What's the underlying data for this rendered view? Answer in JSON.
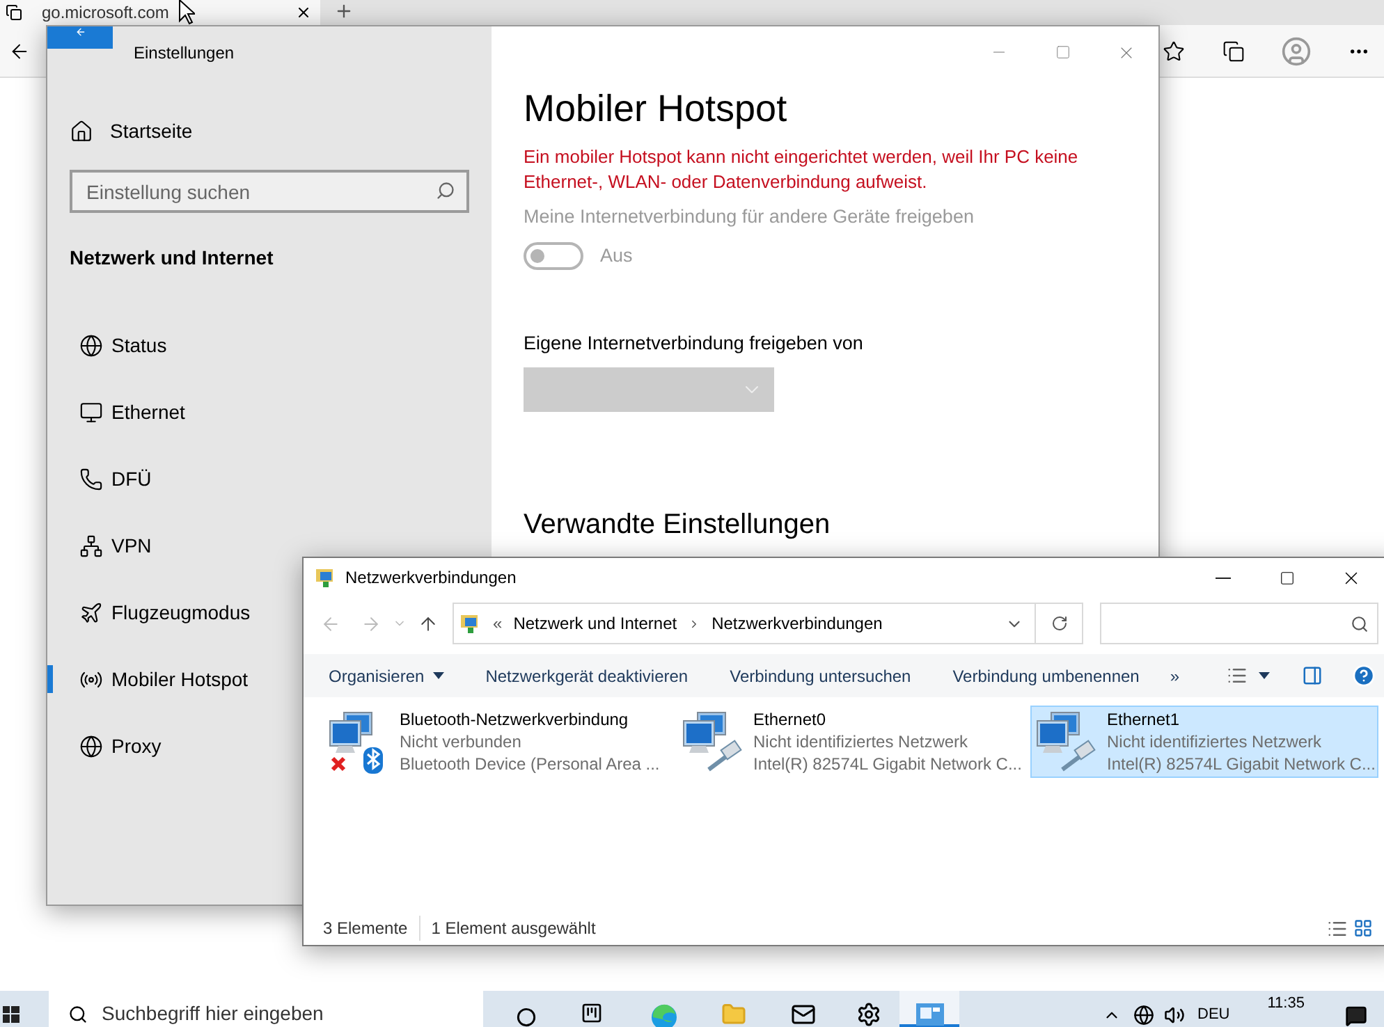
{
  "browser": {
    "tab": {
      "title": "go.microsoft.com"
    }
  },
  "settings": {
    "title": "Einstellungen",
    "home": "Startseite",
    "search": {
      "placeholder": "Einstellung suchen"
    },
    "section": "Netzwerk und Internet",
    "nav": [
      {
        "label": "Status",
        "selected": false
      },
      {
        "label": "Ethernet",
        "selected": false
      },
      {
        "label": "DFÜ",
        "selected": false
      },
      {
        "label": "VPN",
        "selected": false
      },
      {
        "label": "Flugzeugmodus",
        "selected": false
      },
      {
        "label": "Mobiler Hotspot",
        "selected": true
      },
      {
        "label": "Proxy",
        "selected": false
      }
    ],
    "page_title": "Mobiler Hotspot",
    "error": "Ein mobiler Hotspot kann nicht eingerichtet werden, weil Ihr PC keine Ethernet-, WLAN- oder Datenverbindung aufweist.",
    "share_label": "Meine Internetverbindung für andere Geräte freigeben",
    "toggle": {
      "on": false,
      "label": "Aus"
    },
    "source_label": "Eigene Internetverbindung freigeben von",
    "related_heading": "Verwandte Einstellungen"
  },
  "explorer": {
    "title": "Netzwerkverbindungen",
    "address_overflow": "«",
    "breadcrumb": [
      "Netzwerk und Internet",
      "Netzwerkverbindungen"
    ],
    "commands": [
      "Organisieren",
      "Netzwerkgerät deaktivieren",
      "Verbindung untersuchen",
      "Verbindung umbenennen"
    ],
    "more": "»",
    "items": [
      {
        "kind": "bluetooth",
        "name": "Bluetooth-Netzwerkverbindung",
        "status": "Nicht verbunden",
        "device": "Bluetooth Device (Personal Area ...",
        "selected": false
      },
      {
        "kind": "ethernet",
        "name": "Ethernet0",
        "status": "Nicht identifiziertes Netzwerk",
        "device": "Intel(R) 82574L Gigabit Network C...",
        "selected": false
      },
      {
        "kind": "ethernet",
        "name": "Ethernet1",
        "status": "Nicht identifiziertes Netzwerk",
        "device": "Intel(R) 82574L Gigabit Network C...",
        "selected": true
      }
    ],
    "status_bar": [
      "3 Elemente",
      "1 Element ausgewählt"
    ]
  },
  "taskbar": {
    "search": {
      "placeholder": "Suchbegriff hier eingeben"
    },
    "language": "DEU",
    "time": "11:35"
  }
}
